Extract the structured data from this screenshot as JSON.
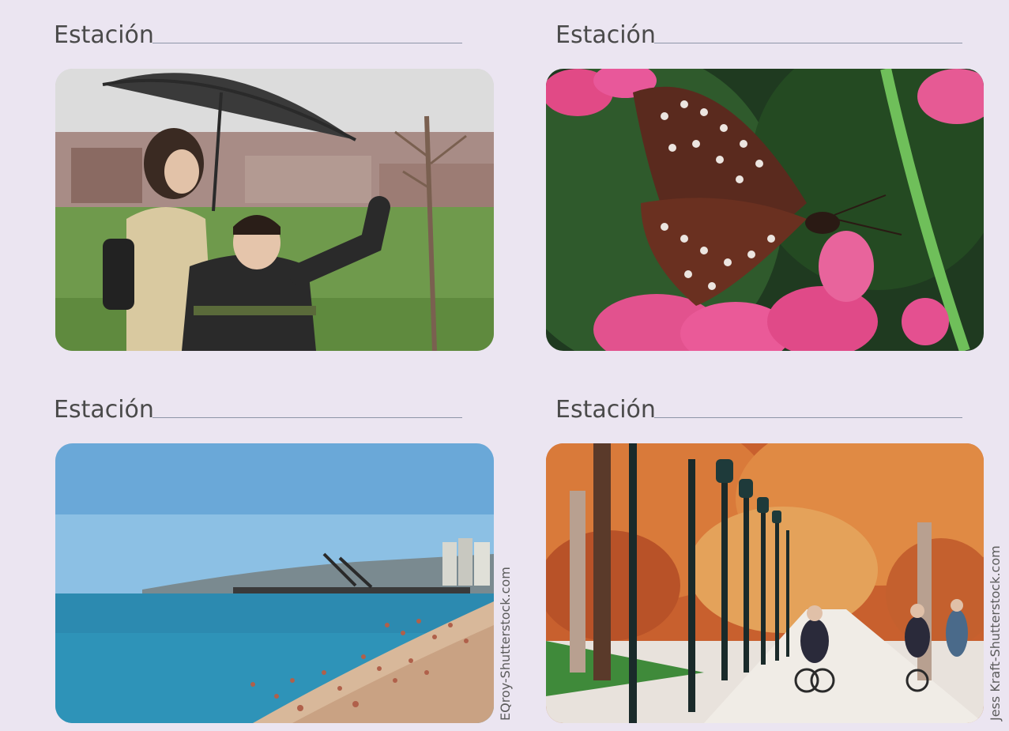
{
  "cards": [
    {
      "label": "Estación",
      "photo_subject": "rain-scene-photo"
    },
    {
      "label": "Estación",
      "photo_subject": "butterfly-photo"
    },
    {
      "label": "Estación",
      "photo_subject": "beach-photo"
    },
    {
      "label": "Estación",
      "photo_subject": "autumn-park-photo"
    }
  ],
  "credits": {
    "left": "EQroy-Shutterstock.com",
    "right": "Jess Kraft-Shutterstock.com"
  },
  "colors": {
    "background": "#ebe5f1",
    "label_text": "#4a4a4a",
    "answer_line": "#8e95a8"
  }
}
